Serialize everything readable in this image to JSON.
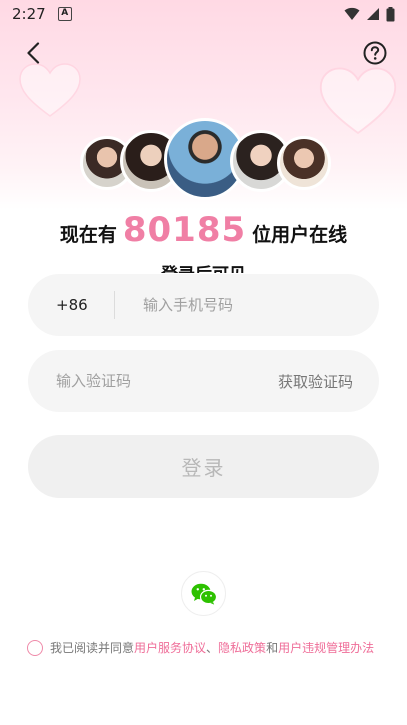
{
  "status_bar": {
    "time": "2:27",
    "indicator": "A"
  },
  "header": {
    "back_icon": "chevron-left-icon",
    "help_icon": "question-circle-icon"
  },
  "online": {
    "prefix": "现在有",
    "count": "80185",
    "suffix": "位用户在线",
    "sub": "登录后可见"
  },
  "phone": {
    "country_code": "+86",
    "placeholder": "输入手机号码"
  },
  "code": {
    "placeholder": "输入验证码",
    "get_code_label": "获取验证码"
  },
  "login": {
    "label": "登录"
  },
  "social": {
    "wechat_icon": "wechat-icon"
  },
  "agreement": {
    "text": "我已阅读并同意",
    "link1": "用户服务协议",
    "sep": "、",
    "link2": "隐私政策",
    "and": "和",
    "link3": "用户违规管理办法"
  },
  "colors": {
    "accent": "#f07fa5",
    "link": "#ef6d98",
    "field_bg": "#f5f5f5",
    "wechat": "#2dc100"
  }
}
